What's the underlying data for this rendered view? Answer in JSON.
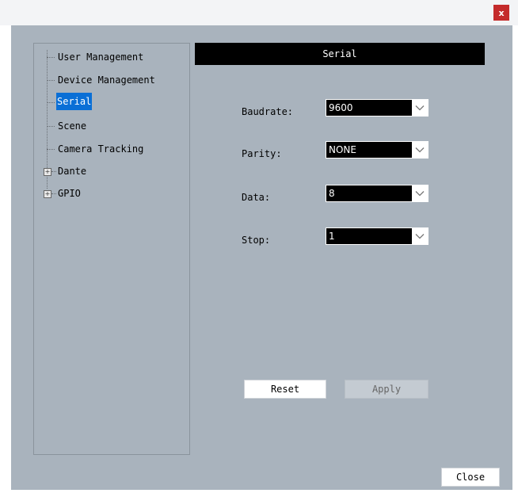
{
  "window": {
    "close_glyph": "x"
  },
  "tree": {
    "items": [
      {
        "label": "User Management",
        "selected": false
      },
      {
        "label": "Device Management",
        "selected": false
      },
      {
        "label": "Serial",
        "selected": true
      },
      {
        "label": "Scene",
        "selected": false
      },
      {
        "label": "Camera Tracking",
        "selected": false
      },
      {
        "label": "Dante",
        "expandable": true,
        "expander": "+"
      },
      {
        "label": "GPIO",
        "expandable": true,
        "expander": "+"
      }
    ]
  },
  "panel": {
    "title": "Serial",
    "fields": [
      {
        "label": "Baudrate:",
        "value": "9600"
      },
      {
        "label": "Parity:",
        "value": "NONE"
      },
      {
        "label": "Data:",
        "value": "8"
      },
      {
        "label": "Stop:",
        "value": "1"
      }
    ]
  },
  "buttons": {
    "reset": "Reset",
    "apply": "Apply",
    "close": "Close"
  }
}
